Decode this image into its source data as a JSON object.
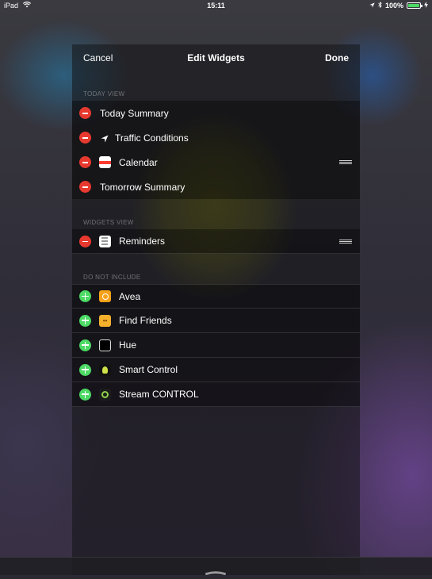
{
  "status_bar": {
    "device": "iPad",
    "time": "15:11",
    "battery": "100%",
    "battery_level": 1.0
  },
  "nav": {
    "cancel": "Cancel",
    "title": "Edit Widgets",
    "done": "Done"
  },
  "sections": {
    "today_view": {
      "header": "TODAY VIEW",
      "items": [
        {
          "label": "Today Summary",
          "icon": "none"
        },
        {
          "label": "Traffic Conditions",
          "icon": "location-arrow-icon"
        },
        {
          "label": "Calendar",
          "icon": "calendar-icon",
          "reorder": true
        },
        {
          "label": "Tomorrow Summary",
          "icon": "none"
        }
      ]
    },
    "widgets_view": {
      "header": "WIDGETS VIEW",
      "items": [
        {
          "label": "Reminders",
          "icon": "reminders-icon",
          "reorder": true
        }
      ]
    },
    "do_not_include": {
      "header": "DO NOT INCLUDE",
      "items": [
        {
          "label": "Avea",
          "icon": "avea-icon"
        },
        {
          "label": "Find Friends",
          "icon": "find-friends-icon"
        },
        {
          "label": "Hue",
          "icon": "hue-icon"
        },
        {
          "label": "Smart Control",
          "icon": "smart-control-icon"
        },
        {
          "label": "Stream CONTROL",
          "icon": "stream-control-icon"
        }
      ]
    }
  },
  "colors": {
    "remove": "#e8392f",
    "add": "#4cd964",
    "battery": "#4cd964"
  }
}
